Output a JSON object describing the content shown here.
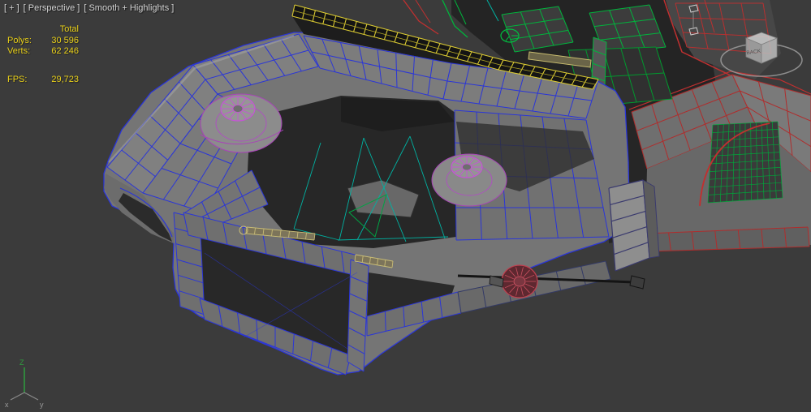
{
  "viewport": {
    "menu_general": "[ + ]",
    "menu_pov": "[ Perspective ]",
    "menu_shading": "[ Smooth + Highlights ]"
  },
  "statistics": {
    "total_label": "Total",
    "rows": [
      {
        "label": "Polys:",
        "value": "30 596"
      },
      {
        "label": "Verts:",
        "value": "62 246"
      }
    ],
    "fps": {
      "label": "FPS:",
      "value": "29,723"
    }
  },
  "viewcube": {
    "visible_face_label": "BACK"
  },
  "axis_tripod": {
    "x_label": "x",
    "y_label": "y",
    "z_label": "Z"
  },
  "colors": {
    "background": "#3b3b3b",
    "viewport_label_text": "#d4d4d4",
    "stats_text": "#e9d019",
    "body_surface_gray": "#787878",
    "body_wire_blue": "#2a35d8",
    "strut_wire_magenta": "#c653d6",
    "interior_wire_green": "#00b43c",
    "chassis_wire_teal": "#00b2a2",
    "rear_wire_red": "#c03030",
    "windshield_wire_yellow": "#d8c832",
    "shock_part_tan": "#c8bc76",
    "hub_part_red": "#c04050"
  }
}
